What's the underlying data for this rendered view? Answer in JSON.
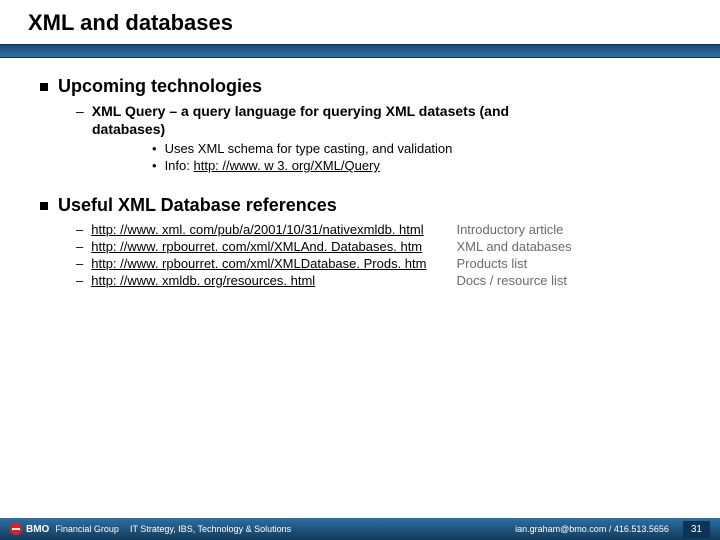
{
  "title": "XML and databases",
  "section1": {
    "heading": "Upcoming technologies",
    "sub": {
      "lead": "XML Query – a query language for querying XML datasets (and",
      "cont": "databases)",
      "points": [
        "Uses XML schema for type casting, and validation",
        "Info: "
      ],
      "link": "http: //www. w 3. org/XML/Query"
    }
  },
  "section2": {
    "heading": "Useful XML Database references",
    "links": [
      "http: //www. xml. com/pub/a/2001/10/31/nativexmldb. html",
      "http: //www. rpbourret. com/xml/XMLAnd. Databases. htm",
      "http: //www. rpbourret. com/xml/XMLDatabase. Prods. htm",
      "http: //www. xmldb. org/resources. html"
    ],
    "descs": [
      "Introductory article",
      "XML and databases",
      "Products list",
      "Docs / resource list"
    ]
  },
  "footer": {
    "brand": "Financial Group",
    "dept": "IT Strategy, IBS, Technology & Solutions",
    "contact": "ian.graham@bmo.com / 416.513.5656",
    "page": "31"
  }
}
